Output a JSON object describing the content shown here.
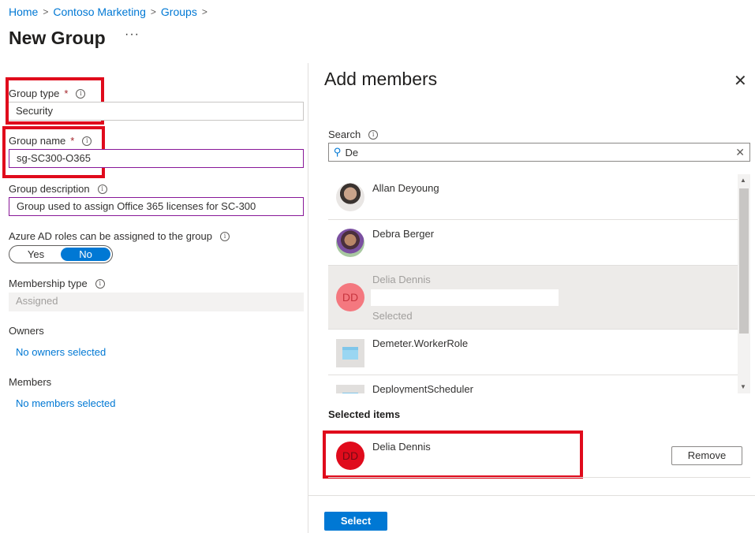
{
  "breadcrumb": {
    "items": [
      "Home",
      "Contoso Marketing",
      "Groups"
    ],
    "separator": ">"
  },
  "page": {
    "title": "New Group",
    "more": "···"
  },
  "form": {
    "group_type": {
      "label": "Group type",
      "required": "*",
      "value": "Security"
    },
    "group_name": {
      "label": "Group name",
      "required": "*",
      "value": "sg-SC300-O365"
    },
    "group_description": {
      "label": "Group description",
      "value": "Group used to assign Office 365 licenses for SC-300"
    },
    "azure_ad_roles": {
      "label": "Azure AD roles can be assigned to the group",
      "options": [
        "Yes",
        "No"
      ],
      "selected": "No"
    },
    "membership_type": {
      "label": "Membership type",
      "value": "Assigned"
    },
    "owners": {
      "label": "Owners",
      "link": "No owners selected"
    },
    "members": {
      "label": "Members",
      "link": "No members selected"
    }
  },
  "info_icon": "i",
  "panel": {
    "title": "Add members",
    "close": "✕",
    "search": {
      "label": "Search",
      "value": "De",
      "clear": "✕",
      "icon": "⚲"
    },
    "results": [
      {
        "name": "Allan Deyoung",
        "avatar": "photo"
      },
      {
        "name": "Debra Berger",
        "avatar": "photo"
      },
      {
        "name": "Delia Dennis",
        "avatar": "initials",
        "initials": "DD",
        "status": "Selected"
      },
      {
        "name": "Demeter.WorkerRole",
        "avatar": "app-icon"
      },
      {
        "name": "DeploymentScheduler",
        "avatar": "app-icon"
      }
    ],
    "selected_heading": "Selected items",
    "selected_items": [
      {
        "name": "Delia Dennis",
        "initials": "DD",
        "remove_label": "Remove"
      }
    ],
    "select_button": "Select"
  },
  "colors": {
    "accent": "#0078d4",
    "highlight_box": "#e00b1c",
    "focus_border": "#881798"
  }
}
